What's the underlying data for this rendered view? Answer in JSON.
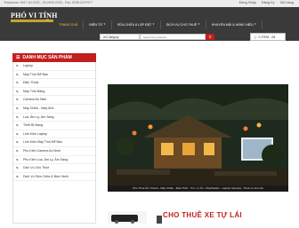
{
  "topbar": {
    "phones": "Telephone: 0917.40.2222 - 09.2929.2222 - Fax: 0236.2227977",
    "links": [
      "Đăng Nhập",
      "Đăng Ký",
      "Giỏ hàng"
    ]
  },
  "brand": {
    "title": "PHÓ VI TÍNH",
    "tagline": "vn",
    "accent": "#c21f1f",
    "header_bg": "#3a3a3a"
  },
  "nav": [
    {
      "label": "TRANG CHỦ",
      "active": true,
      "caret": false
    },
    {
      "label": "ĐIỆN TỬ",
      "active": false,
      "caret": true
    },
    {
      "label": "SỬA CHỮA & LẮP ĐẶT",
      "active": false,
      "caret": true
    },
    {
      "label": "DỊCH VỤ CHO THUÊ",
      "active": false,
      "caret": true
    },
    {
      "label": "KHUYẾN MÃI & HÀNG HIỆU",
      "active": false,
      "caret": true
    }
  ],
  "search": {
    "category_selected": "All Category",
    "placeholder": "Search by products",
    "button_icon": "search-icon"
  },
  "cart": {
    "label": "0 ITEM - 0đ",
    "icon": "cart-icon"
  },
  "sidebar": {
    "title": "DANH MỤC SẢN PHẨM",
    "items": [
      "Laptop",
      "Máy Tính Để Bàn",
      "Điện Thoại",
      "Máy Tính Bảng",
      "Camera An Ninh",
      "Máy Chiếu - Máy Ảnh",
      "Loa, Âm Ly, Âm Sáng",
      "Thiết Bị Mạng",
      "Linh Kiện Laptop",
      "Linh Kiện Máy Tính Để Bàn",
      "Phụ Kiện Camera An Ninh",
      "Phụ Kiện Loa, Âm Ly, Âm Sáng",
      "Dịch Vụ Cho Thuê",
      "Dịch Vụ Sửa Chữa & Bảo Hành"
    ]
  },
  "banner": {
    "caption": "Cho Thuê Âm Thanh - Máy Chiếu - Màn Hình - Tivi - In Ấn - PlayStation - Laptop Gaming - Thuê xe Du Lịch"
  },
  "promo": {
    "text": "CHO THUÊ XE TỰ LÁI"
  }
}
